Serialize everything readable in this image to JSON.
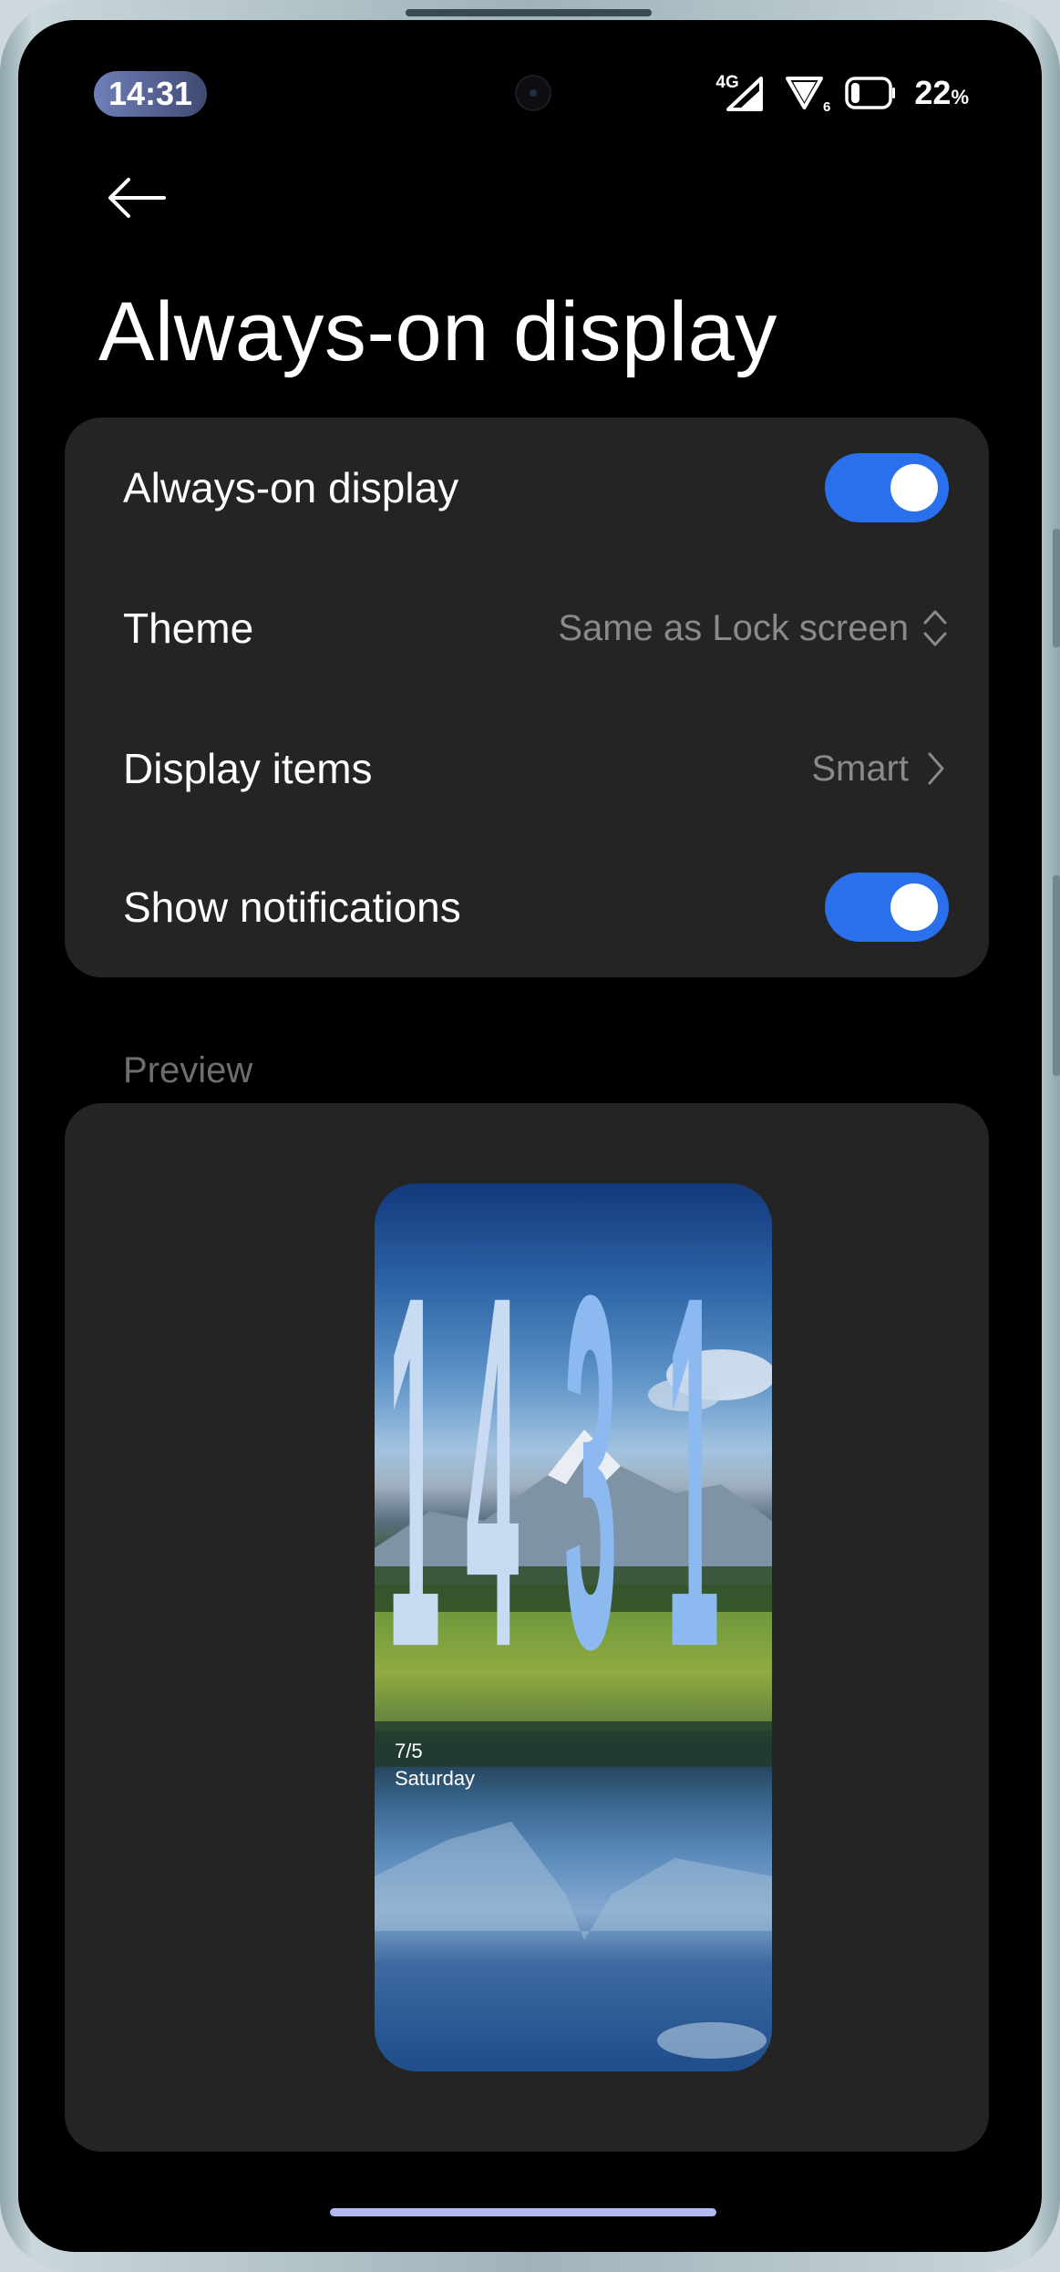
{
  "status_bar": {
    "time": "14:31",
    "network": "4G",
    "wifi_badge": "6",
    "battery_value": "22",
    "battery_unit": "%"
  },
  "header": {
    "back_icon": "back-arrow-icon",
    "title": "Always-on display"
  },
  "settings": {
    "aod_label": "Always-on display",
    "aod_enabled": true,
    "theme_label": "Theme",
    "theme_value": "Same as Lock screen",
    "display_items_label": "Display items",
    "display_items_value": "Smart",
    "notifications_label": "Show notifications",
    "notifications_enabled": true
  },
  "preview": {
    "section_label": "Preview",
    "clock_digits": [
      "1",
      "4",
      "3",
      "1"
    ],
    "date": "7/5",
    "weekday": "Saturday"
  },
  "colors": {
    "accent": "#2a70ec",
    "card": "#242424",
    "background": "#000000"
  }
}
